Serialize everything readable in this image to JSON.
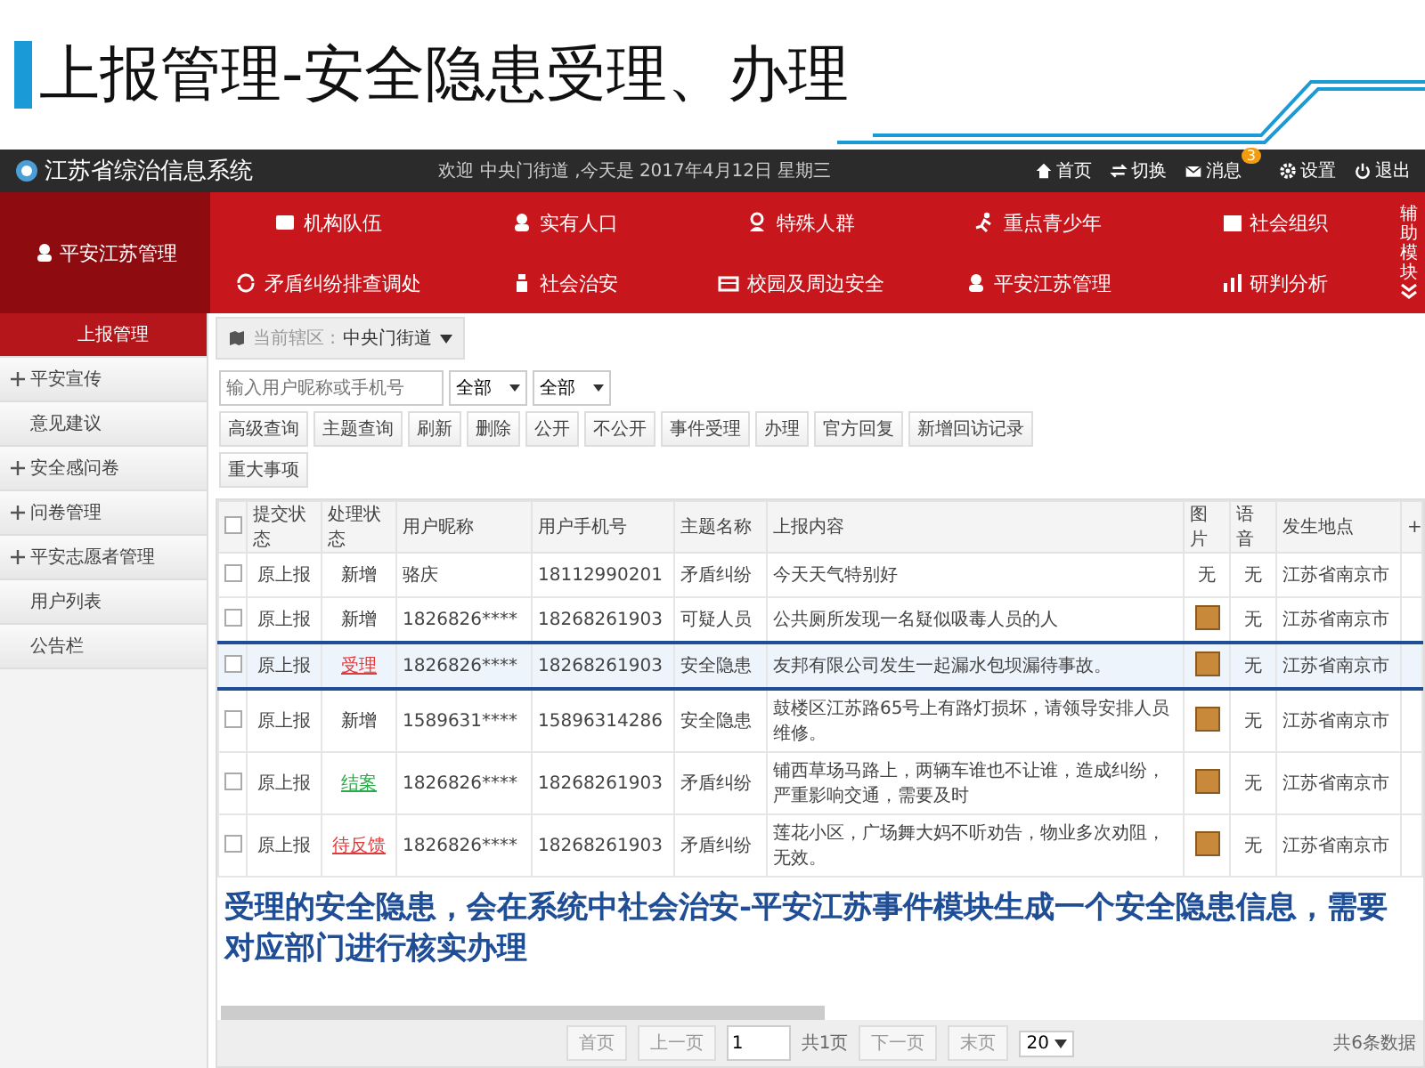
{
  "slide_title": "上报管理-安全隐患受理、办理",
  "header": {
    "app_name": "江苏省综治信息系统",
    "welcome": "欢迎 中央门街道 ,今天是 2017年4月12日 星期三",
    "links": [
      {
        "label": "首页"
      },
      {
        "label": "切换"
      },
      {
        "label": "消息",
        "badge": "3"
      },
      {
        "label": "设置"
      },
      {
        "label": "退出"
      }
    ]
  },
  "nav": {
    "current": "平安江苏管理",
    "items": [
      {
        "label": "机构队伍"
      },
      {
        "label": "实有人口"
      },
      {
        "label": "特殊人群"
      },
      {
        "label": "重点青少年"
      },
      {
        "label": "社会组织"
      },
      {
        "label": "矛盾纠纷排查调处"
      },
      {
        "label": "社会治安"
      },
      {
        "label": "校园及周边安全"
      },
      {
        "label": "平安江苏管理"
      },
      {
        "label": "研判分析"
      }
    ],
    "side_label": "辅助模块"
  },
  "sidebar": {
    "items": [
      {
        "label": "上报管理",
        "selected": true,
        "expandable": false
      },
      {
        "label": "平安宣传",
        "selected": false,
        "expandable": true
      },
      {
        "label": "意见建议",
        "selected": false,
        "expandable": false
      },
      {
        "label": "安全感问卷",
        "selected": false,
        "expandable": true
      },
      {
        "label": "问卷管理",
        "selected": false,
        "expandable": true
      },
      {
        "label": "平安志愿者管理",
        "selected": false,
        "expandable": true
      },
      {
        "label": "用户列表",
        "selected": false,
        "expandable": false
      },
      {
        "label": "公告栏",
        "selected": false,
        "expandable": false
      }
    ]
  },
  "breadcrumb": {
    "label": "当前辖区 :",
    "value": "中央门街道"
  },
  "toolbar": {
    "search": {
      "placeholder": "输入用户昵称或手机号"
    },
    "selects": [
      {
        "value": "全部"
      },
      {
        "value": "全部"
      }
    ],
    "buttons": [
      "高级查询",
      "主题查询",
      "刷新",
      "删除",
      "公开",
      "不公开",
      "事件受理",
      "办理",
      "官方回复",
      "新增回访记录",
      "重大事项"
    ]
  },
  "table": {
    "select_all_checked": false,
    "columns": [
      "提交状态",
      "处理状态",
      "用户昵称",
      "用户手机号",
      "主题名称",
      "上报内容",
      "图片",
      "语音",
      "发生地点",
      "+"
    ],
    "rows": [
      {
        "checked": false,
        "highlighted": false,
        "submit": "原上报",
        "status": {
          "text": "新增",
          "color": "#333333"
        },
        "nickname": "骆庆",
        "phone": "18112990201",
        "topic": "矛盾纠纷",
        "content": "今天天气特别好",
        "image": {
          "kind": "none",
          "text": "无"
        },
        "voice": "无",
        "location": "江苏省南京市"
      },
      {
        "checked": false,
        "highlighted": false,
        "submit": "原上报",
        "status": {
          "text": "新增",
          "color": "#333333"
        },
        "nickname": "1826826****",
        "phone": "18268261903",
        "topic": "可疑人员",
        "content": "公共厕所发现一名疑似吸毒人员的人",
        "image": {
          "kind": "photo"
        },
        "voice": "无",
        "location": "江苏省南京市"
      },
      {
        "checked": false,
        "highlighted": true,
        "submit": "原上报",
        "status": {
          "text": "受理",
          "color": "#e03c3c"
        },
        "nickname": "1826826****",
        "phone": "18268261903",
        "topic": "安全隐患",
        "content": "友邦有限公司发生一起漏水包坝漏待事故。",
        "image": {
          "kind": "photo"
        },
        "voice": "无",
        "location": "江苏省南京市"
      },
      {
        "checked": false,
        "highlighted": false,
        "submit": "原上报",
        "status": {
          "text": "新增",
          "color": "#333333"
        },
        "nickname": "1589631****",
        "phone": "15896314286",
        "topic": "安全隐患",
        "content": "鼓楼区江苏路65号上有路灯损坏，请领导安排人员维修。",
        "image": {
          "kind": "photo"
        },
        "voice": "无",
        "location": "江苏省南京市"
      },
      {
        "checked": false,
        "highlighted": false,
        "submit": "原上报",
        "status": {
          "text": "结案",
          "color": "#2ca84a"
        },
        "nickname": "1826826****",
        "phone": "18268261903",
        "topic": "矛盾纠纷",
        "content": "铺西草场马路上，两辆车谁也不让谁，造成纠纷，严重影响交通，需要及时",
        "image": {
          "kind": "photo"
        },
        "voice": "无",
        "location": "江苏省南京市"
      },
      {
        "checked": false,
        "highlighted": false,
        "submit": "原上报",
        "status": {
          "text": "待反馈",
          "color": "#e03c3c"
        },
        "nickname": "1826826****",
        "phone": "18268261903",
        "topic": "矛盾纠纷",
        "content": "莲花小区，广场舞大妈不听劝告，物业多次劝阻，无效。",
        "image": {
          "kind": "photo"
        },
        "voice": "无",
        "location": "江苏省南京市"
      }
    ]
  },
  "annotation": "受理的安全隐患，会在系统中社会治安-平安江苏事件模块生成一个安全隐患信息，需要对应部门进行核实办理",
  "pagination": {
    "first": "首页",
    "prev": "上一页",
    "page": "1",
    "total_pages": "共1页",
    "next": "下一页",
    "last": "末页",
    "page_size": "20",
    "count": "共6条数据"
  }
}
